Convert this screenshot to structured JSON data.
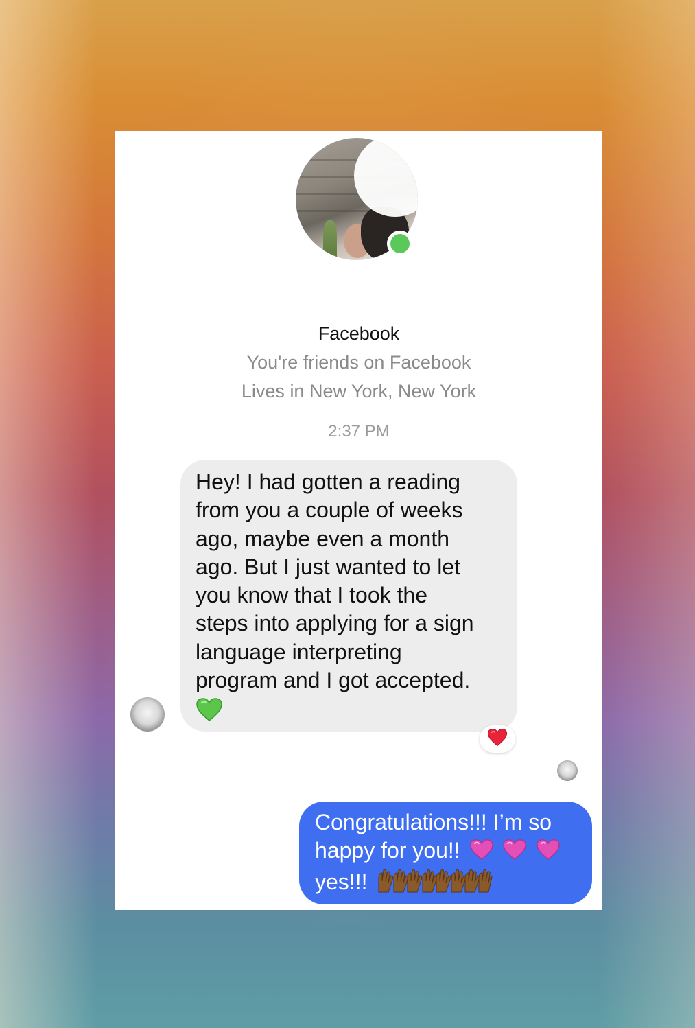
{
  "background": {
    "top_color": "#d9a04a",
    "middle_color": "#b04d5c",
    "bottom_color": "#5f9da5"
  },
  "profile": {
    "name_redacted": "",
    "platform": "Facebook",
    "friends_text": "You're friends on Facebook",
    "location_text": "Lives in New York, New York",
    "online": true,
    "online_color": "#5ac95a"
  },
  "conversation": {
    "timestamp": "2:37 PM",
    "incoming": {
      "text": "Hey! I had gotten a reading\nfrom you a couple of weeks\nago, maybe even a month\nago. But I just wanted to let\nyou know that I took the\nsteps into applying for a sign\nlanguage interpreting\nprogram and I got accepted.",
      "trailing_emoji": "green-heart",
      "reaction": "red-heart",
      "bubble_color": "#ededed"
    },
    "outgoing": {
      "line1": "Congratulations!!! I’m so",
      "line2": "happy for you!!",
      "line2_emojis": [
        "sparkling-heart",
        "sparkling-heart",
        "sparkling-heart"
      ],
      "line3": "yes!!!",
      "line3_emojis": [
        "raising-hands",
        "raising-hands",
        "raising-hands",
        "raising-hands"
      ],
      "bubble_color": "#3f6ff0"
    }
  }
}
